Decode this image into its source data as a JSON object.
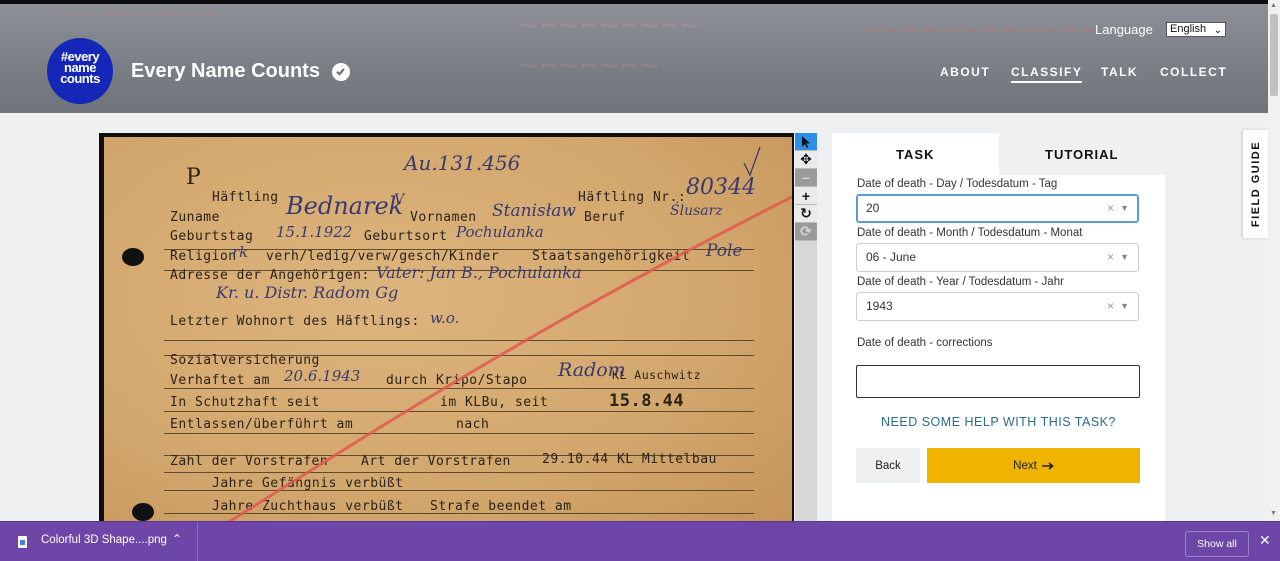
{
  "header": {
    "logo_lines": [
      "#every",
      "name",
      "counts"
    ],
    "site_title": "Every Name Counts",
    "language_label": "Language",
    "language_value": "English",
    "nav": [
      {
        "label": "ABOUT"
      },
      {
        "label": "CLASSIFY"
      },
      {
        "label": "TALK"
      },
      {
        "label": "COLLECT"
      }
    ]
  },
  "subject": {
    "typed": {
      "haeftling": "Häftling",
      "haeftling_nr": "Häftling Nr.:",
      "zuname": "Zuname",
      "vornamen": "Vornamen",
      "beruf": "Beruf",
      "geburtstag": "Geburtstag",
      "geburtsort": "Geburtsort",
      "religion": "Religion",
      "religion_opts": "verh/ledig/verw/gesch/Kinder",
      "staatsangehoerigkeit": "Staatsangehörigkeit",
      "adresse": "Adresse der Angehörigen:",
      "letzter_wohnort": "Letzter Wohnort des Häftlings:",
      "sozialversicherung": "Sozialversicherung",
      "verhaftet": "Verhaftet am",
      "durch": "durch Kripo/Stapo",
      "kl_auschwitz": "KL Auschwitz",
      "schutzhaft": "In Schutzhaft seit",
      "im_klbu": "im KLBu, seit",
      "date_stamp": "15.8.44",
      "entlassen": "Entlassen/überführt am",
      "nach": "nach",
      "vorstrafen": "Zahl der Vorstrafen",
      "art_vorstrafen": "Art der Vorstrafen",
      "mittelbau": "29.10.44 KL Mittelbau",
      "gefaengnis": "Jahre Gefängnis verbüßt",
      "zuchthaus": "Jahre Zuchthaus verbüßt",
      "strafe_beendet": "Strafe beendet am"
    },
    "handwritten": {
      "top_number": "Au.131.456",
      "prefix_p": "P",
      "prisoner_number": "80344",
      "surname": "Bednarek",
      "first_name": "Stanisław",
      "occupation": "Ślusarz",
      "birth_date": "15.1.1922",
      "birthplace": "Pochulanka",
      "religion": "rk",
      "nationality": "Pole",
      "relatives": "Vater: Jan B., Pochulanka",
      "district": "Kr. u. Distr. Radom Gg",
      "last_residence": "w.o.",
      "arrest_date": "20.6.1943",
      "arrest_place": "Radom",
      "v_mark": "V"
    }
  },
  "tools": [
    "pointer-tool",
    "move-tool",
    "zoom-out",
    "zoom-in",
    "rotate",
    "reset"
  ],
  "panel": {
    "tabs": {
      "task": "TASK",
      "tutorial": "TUTORIAL"
    },
    "day_label": "Date of death - Day / Todesdatum - Tag",
    "day_value": "20",
    "month_label": "Date of death - Month / Todesdatum - Monat",
    "month_value": "06 - June",
    "year_label": "Date of death - Year / Todesdatum - Jahr",
    "year_value": "1943",
    "corrections_label": "Date of death - corrections",
    "corrections_value": "",
    "clear_glyph": "×",
    "help_link": "NEED SOME HELP WITH THIS TASK?",
    "back_label": "Back",
    "next_label": "Next"
  },
  "field_guide": "FIELD GUIDE",
  "download_bar": {
    "file_name": "Colorful 3D Shape....png",
    "show_all": "Show all"
  },
  "colors": {
    "brand_blue": "#1427b8",
    "next_button": "#f0b300",
    "help_link": "#2a6e83",
    "download_bar": "#6e46a8",
    "active_tool": "#2b8fe8"
  }
}
